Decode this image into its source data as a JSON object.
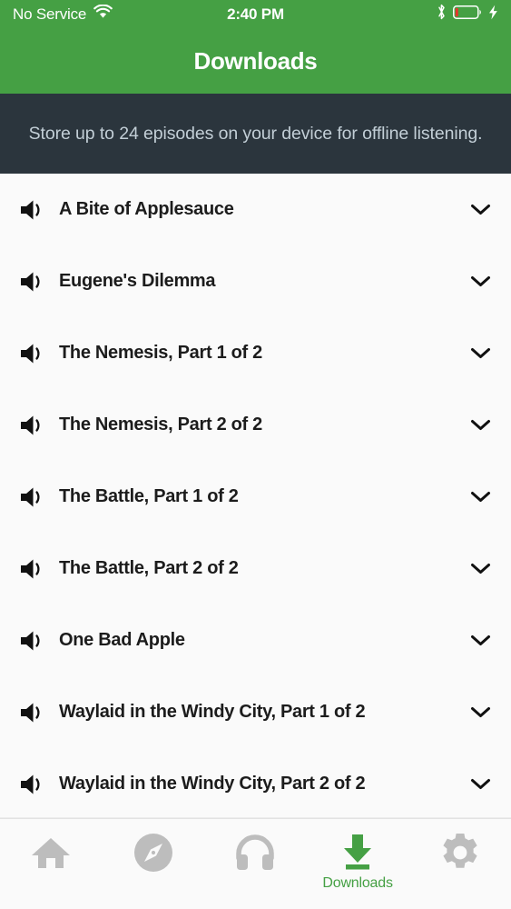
{
  "theme": {
    "brand_green": "#45a044",
    "banner_bg": "#2b353d",
    "banner_text_color": "#c2ced6",
    "list_bg": "#fafafa",
    "tab_inactive": "#bdbdbd",
    "title_color": "#1c1c1c"
  },
  "status_bar": {
    "carrier": "No Service",
    "wifi_icon": "wifi-icon",
    "time": "2:40 PM",
    "bluetooth_icon": "bluetooth-icon",
    "battery_icon": "battery-low-icon",
    "battery_level_percent": 8,
    "charging_icon": "lightning-bolt-icon"
  },
  "nav": {
    "title": "Downloads"
  },
  "banner": {
    "message": "Store up to 24 episodes on your device for offline listening.",
    "episode_limit": 24
  },
  "list": {
    "rows": [
      {
        "title": "A Bite of Applesauce",
        "leading_icon": "speaker-icon",
        "trailing_icon": "chevron-down-icon"
      },
      {
        "title": "Eugene's Dilemma",
        "leading_icon": "speaker-icon",
        "trailing_icon": "chevron-down-icon"
      },
      {
        "title": "The Nemesis, Part 1 of 2",
        "leading_icon": "speaker-icon",
        "trailing_icon": "chevron-down-icon"
      },
      {
        "title": "The Nemesis, Part 2 of 2",
        "leading_icon": "speaker-icon",
        "trailing_icon": "chevron-down-icon"
      },
      {
        "title": "The Battle, Part 1 of 2",
        "leading_icon": "speaker-icon",
        "trailing_icon": "chevron-down-icon"
      },
      {
        "title": "The Battle, Part 2 of 2",
        "leading_icon": "speaker-icon",
        "trailing_icon": "chevron-down-icon"
      },
      {
        "title": "One Bad Apple",
        "leading_icon": "speaker-icon",
        "trailing_icon": "chevron-down-icon"
      },
      {
        "title": "Waylaid in the Windy City, Part 1 of 2",
        "leading_icon": "speaker-icon",
        "trailing_icon": "chevron-down-icon"
      },
      {
        "title": "Waylaid in the Windy City, Part 2 of 2",
        "leading_icon": "speaker-icon",
        "trailing_icon": "chevron-down-icon"
      }
    ]
  },
  "tabbar": {
    "tabs": [
      {
        "icon": "home-icon",
        "label": "",
        "active": false
      },
      {
        "icon": "compass-icon",
        "label": "",
        "active": false
      },
      {
        "icon": "headphones-icon",
        "label": "",
        "active": false
      },
      {
        "icon": "download-icon",
        "label": "Downloads",
        "active": true
      },
      {
        "icon": "gear-icon",
        "label": "",
        "active": false
      }
    ]
  }
}
